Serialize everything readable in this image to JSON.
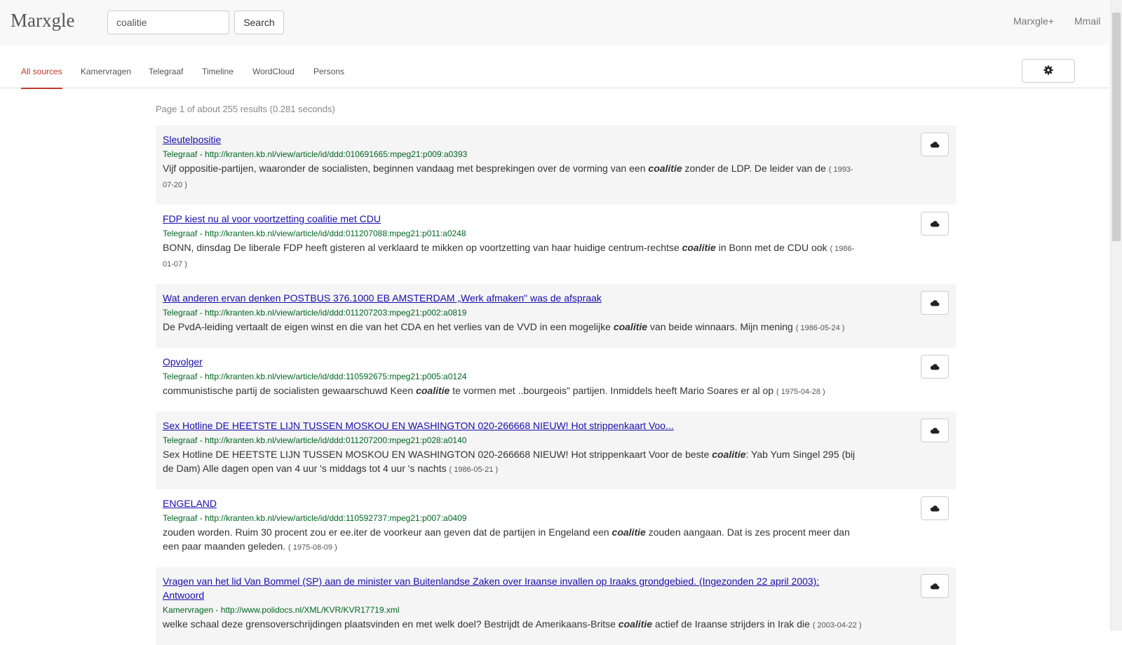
{
  "brand": "Marxgle",
  "search": {
    "value": "coalitie",
    "button_label": "Search"
  },
  "top_links": [
    "Marxgle+",
    "Mmail"
  ],
  "tabs": [
    {
      "label": "All sources",
      "active": true
    },
    {
      "label": "Kamervragen",
      "active": false
    },
    {
      "label": "Telegraaf",
      "active": false
    },
    {
      "label": "Timeline",
      "active": false
    },
    {
      "label": "WordCloud",
      "active": false
    },
    {
      "label": "Persons",
      "active": false
    }
  ],
  "settings_icon": "gear-icon",
  "results_meta": "Page 1 of about 255 results (0.281 seconds)",
  "results": [
    {
      "title": "Sleutelpositie",
      "source": "Telegraaf",
      "url": "http://kranten.kb.nl/view/article/id/ddd:010691665:mpeg21:p009:a0393",
      "snippet_before": "Vijf oppositie-partijen, waaronder de socialisten, beginnen vandaag met besprekingen over de vorming van een",
      "highlight": "coalitie",
      "snippet_after": "zonder de LDP. De leider van de",
      "date": "( 1993-07-20 )"
    },
    {
      "title": "FDP kiest nu al voor voortzetting coalitie met CDU",
      "source": "Telegraaf",
      "url": "http://kranten.kb.nl/view/article/id/ddd:011207088:mpeg21:p011:a0248",
      "snippet_before": "BONN, dinsdag De liberale FDP heeft gisteren al verklaard te mikken op voortzetting van haar huidige centrum-rechtse",
      "highlight": "coalitie",
      "snippet_after": "in Bonn met de CDU ook",
      "date": "( 1986-01-07 )"
    },
    {
      "title": "Wat anderen ervan denken POSTBUS 376.1000 EB AMSTERDAM „Werk afmaken\" was de afspraak",
      "source": "Telegraaf",
      "url": "http://kranten.kb.nl/view/article/id/ddd:011207203:mpeg21:p002:a0819",
      "snippet_before": "De PvdA-leiding vertaalt de eigen winst en die van het CDA en het verlies van de VVD in een mogelijke",
      "highlight": "coalitie",
      "snippet_after": "van beide winnaars. Mijn mening",
      "date": "( 1986-05-24 )"
    },
    {
      "title": "Opvolger",
      "source": "Telegraaf",
      "url": "http://kranten.kb.nl/view/article/id/ddd:110592675:mpeg21:p005:a0124",
      "snippet_before": "communistische partij de socialisten gewaarschuwd Keen",
      "highlight": "coalitie",
      "snippet_after": "te vormen met ..bourgeois\" partijen. Inmiddels heeft Mario Soares er al op",
      "date": "( 1975-04-28 )"
    },
    {
      "title": "Sex Hotline DE HEETSTE LIJN TUSSEN MOSKOU EN WASHINGTON 020-266668 NIEUW! Hot strippenkaart Voo...",
      "source": "Telegraaf",
      "url": "http://kranten.kb.nl/view/article/id/ddd:011207200:mpeg21:p028:a0140",
      "snippet_before": "Sex Hotline DE HEETSTE LIJN TUSSEN MOSKOU EN WASHINGTON 020-266668 NIEUW! Hot strippenkaart Voor de beste",
      "highlight": "coalitie",
      "snippet_after": ": Yab Yum Singel 295 (bij de Dam) Alle dagen open van 4 uur 's middags tot 4 uur 's nachts",
      "date": "( 1986-05-21 )"
    },
    {
      "title": "ENGELAND",
      "source": "Telegraaf",
      "url": "http://kranten.kb.nl/view/article/id/ddd:110592737:mpeg21:p007:a0409",
      "snippet_before": "zouden worden. Ruim 30 procent zou er ee.iter de voorkeur aan geven dat de partijen in Engeland een",
      "highlight": "coalitie",
      "snippet_after": "zouden aangaan. Dat is zes procent meer dan een paar maanden geleden.",
      "date": "( 1975-08-09 )"
    },
    {
      "title": "Vragen van het lid Van Bommel (SP) aan de minister van Buitenlandse Zaken over Iraanse invallen op Iraaks grondgebied. (Ingezonden 22 april 2003): Antwoord",
      "source": "Kamervragen",
      "url": "http://www.polidocs.nl/XML/KVR/KVR17719.xml",
      "snippet_before": "welke schaal deze grensoverschrijdingen plaatsvinden en met welk doel? Bestrijdt de Amerikaans-Britse",
      "highlight": "coalitie",
      "snippet_after": "actief de Iraanse strijders in Irak die",
      "date": "( 2003-04-22 )"
    }
  ],
  "result_action_icon": "cloud-icon"
}
